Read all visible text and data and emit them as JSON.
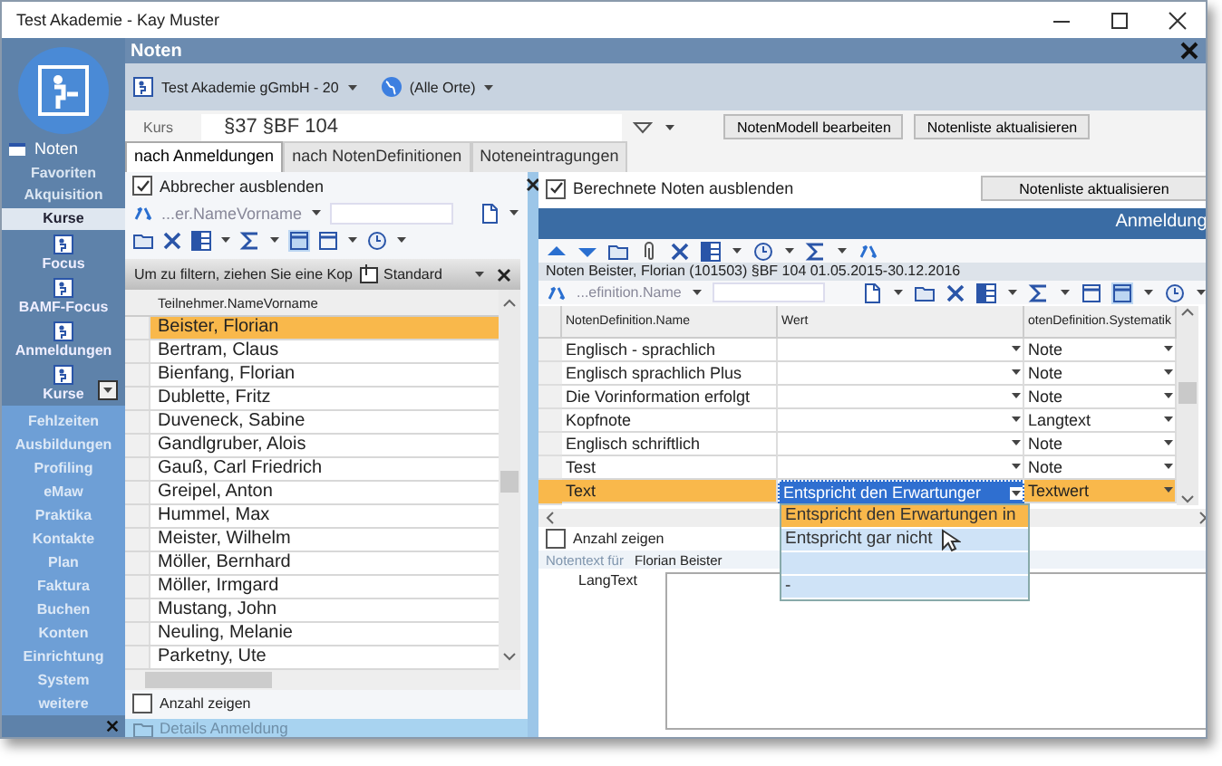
{
  "window": {
    "title": "Test Akademie - Kay Muster"
  },
  "sidebar": {
    "header": "Noten",
    "items": [
      {
        "label": "Favoriten",
        "selected": false
      },
      {
        "label": "Akquisition",
        "selected": false
      },
      {
        "label": "Kurse",
        "selected": true
      }
    ],
    "shortcuts": [
      {
        "label": "Focus"
      },
      {
        "label": "BAMF-Focus"
      },
      {
        "label": "Anmeldungen"
      },
      {
        "label": "Kurse",
        "kind": "menu"
      }
    ],
    "modules": [
      "Fehlzeiten",
      "Ausbildungen",
      "Profiling",
      "eMaw",
      "Praktika",
      "Kontakte",
      "Plan",
      "Faktura",
      "Buchen",
      "Konten",
      "Einrichtung",
      "System",
      "weitere"
    ]
  },
  "page": {
    "title": "Noten",
    "organization": "Test Akademie gGmbH - 20",
    "location": "(Alle Orte)",
    "course_label": "Kurs",
    "course": "§37 §BF 104",
    "buttons": [
      "NotenModell bearbeiten",
      "Notenliste aktualisieren"
    ]
  },
  "tabs": [
    {
      "label": "nach Anmeldungen",
      "selected": true
    },
    {
      "label": "nach NotenDefinitionen",
      "selected": false
    },
    {
      "label": "Noteneintragungen",
      "selected": false
    }
  ],
  "participants": {
    "hide_dropouts": {
      "label": "Abbrecher ausblenden",
      "checked": true
    },
    "filter_column": "...er.NameVorname",
    "group_hint": "Um zu filtern, ziehen Sie eine Kop",
    "layout": "Standard",
    "column": "Teilnehmer.NameVorname",
    "rows": [
      {
        "name": "Beister, Florian",
        "selected": true
      },
      {
        "name": "Bertram, Claus",
        "selected": false
      },
      {
        "name": "Bienfang, Florian",
        "selected": false
      },
      {
        "name": "Dublette, Fritz",
        "selected": false
      },
      {
        "name": "Duveneck, Sabine",
        "selected": false
      },
      {
        "name": "Gandlgruber, Alois",
        "selected": false
      },
      {
        "name": "Gauß, Carl Friedrich",
        "selected": false
      },
      {
        "name": "Greipel, Anton",
        "selected": false
      },
      {
        "name": "Hummel, Max",
        "selected": false
      },
      {
        "name": "Meister, Wilhelm",
        "selected": false
      },
      {
        "name": "Möller, Bernhard",
        "selected": false
      },
      {
        "name": "Möller, Irmgard",
        "selected": false
      },
      {
        "name": "Mustang, John",
        "selected": false
      },
      {
        "name": "Neuling, Melanie",
        "selected": false
      },
      {
        "name": "Parketny, Ute",
        "selected": false
      }
    ],
    "show_count": {
      "label": "Anzahl zeigen",
      "checked": false
    },
    "details": "Details Anmeldung"
  },
  "grades": {
    "hide_calculated": {
      "label": "Berechnete Noten ausblenden",
      "checked": true
    },
    "refresh": "Notenliste aktualisieren",
    "section": "Anmeldung",
    "caption": "Noten Beister, Florian (101503)  §BF 104  01.05.2015-30.12.2016",
    "filter_column": "...efinition.Name",
    "columns": [
      "NotenDefinition.Name",
      "Wert",
      "otenDefinition.Systematik"
    ],
    "rows": [
      {
        "name": "Englisch - sprachlich",
        "value": "",
        "system": "Note",
        "selected": false
      },
      {
        "name": "Englisch sprachlich Plus",
        "value": "",
        "system": "Note",
        "selected": false
      },
      {
        "name": "Die Vorinformation erfolgt",
        "value": "",
        "system": "Note",
        "selected": false
      },
      {
        "name": "Kopfnote",
        "value": "",
        "system": "Langtext",
        "selected": false
      },
      {
        "name": "Englisch schriftlich",
        "value": "",
        "system": "Note",
        "selected": false
      },
      {
        "name": "Test",
        "value": "",
        "system": "Note",
        "selected": false
      },
      {
        "name": "Text",
        "value": "Entspricht den Erwartunger",
        "system": "Textwert",
        "selected": true
      }
    ],
    "options": [
      {
        "kind": "text",
        "label": "Entspricht den Erwartungen in",
        "selected": true
      },
      {
        "kind": "text",
        "label": "Entspricht gar nicht",
        "selected": false
      },
      {
        "kind": "blank",
        "selected": false
      },
      {
        "kind": "text",
        "label": "-",
        "selected": false
      }
    ],
    "show_count": {
      "label": "Anzahl zeigen",
      "checked": false
    },
    "note_for_label": "Notentext für",
    "note_for": "Florian Beister",
    "long_text_label": "LangText"
  }
}
